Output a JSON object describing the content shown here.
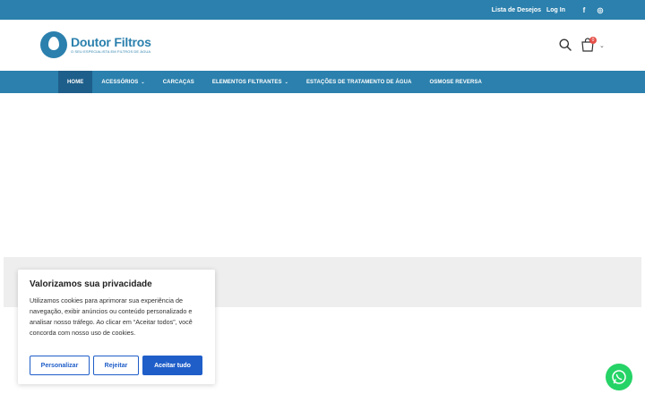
{
  "topbar": {
    "wishlist": "Lista de Desejos",
    "login": "Log In",
    "social": [
      {
        "icon": "facebook-icon",
        "glyph": "f"
      },
      {
        "icon": "instagram-icon",
        "glyph": "◎"
      }
    ]
  },
  "header": {
    "logo_title": "Doutor Filtros",
    "logo_subtitle": "O SEU ESPECIALISTA EM FILTROS DE ÁGUA",
    "cart_count": "0"
  },
  "nav": {
    "items": [
      {
        "label": "HOME",
        "active": true
      },
      {
        "label": "ACESSÓRIOS",
        "dropdown": true
      },
      {
        "label": "CARCAÇAS"
      },
      {
        "label": "ELEMENTOS FILTRANTES",
        "dropdown": true
      },
      {
        "label": "ESTAÇÕES DE TRATAMENTO DE ÁGUA"
      },
      {
        "label": "OSMOSE REVERSA"
      }
    ]
  },
  "cookie": {
    "title": "Valorizamos sua privacidade",
    "body": "Utilizamos cookies para aprimorar sua experiência de navegação, exibir anúncios ou conteúdo personalizado e analisar nosso tráfego. Ao clicar em “Aceitar todos”, você concorda com nosso uso de cookies.",
    "customize": "Personalizar",
    "reject": "Rejeitar",
    "accept": "Aceitar tudo"
  },
  "colors": {
    "brand": "#2b80ad",
    "accent": "#1f5ec9",
    "whatsapp": "#25d366"
  }
}
